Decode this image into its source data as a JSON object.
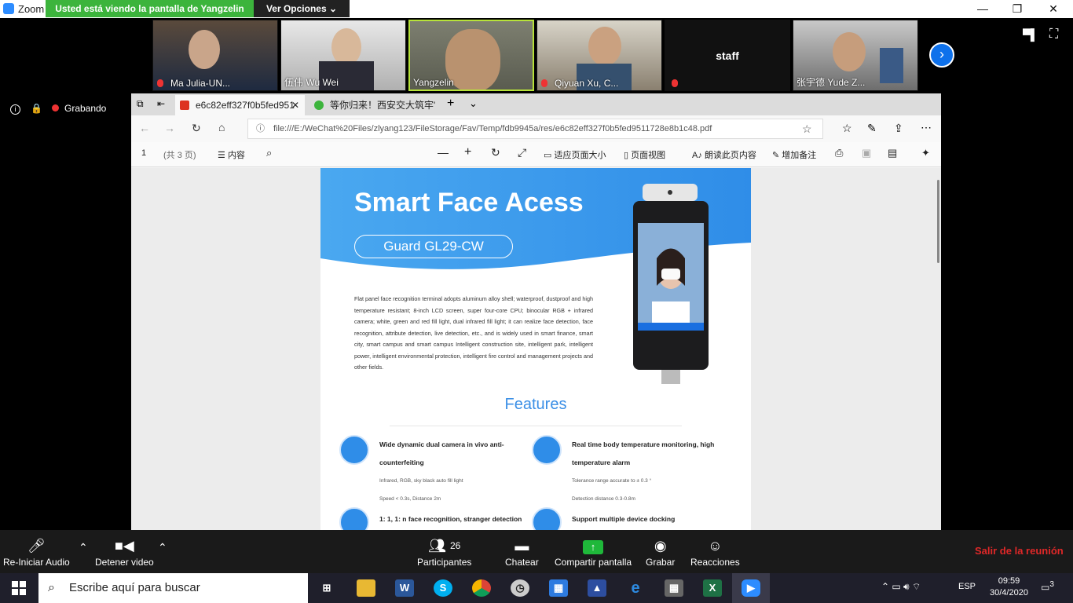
{
  "zoom": {
    "app_title": "Zoom",
    "share_banner": "Usted está viendo la pantalla de Yangzelin",
    "view_options": "Ver Opciones",
    "staff_tile": "staff",
    "recording_label": "Grabando",
    "participants": [
      {
        "name": "Ma Julia-UN..."
      },
      {
        "name": "伍伟   Wu Wei"
      },
      {
        "name": "Yangzelin"
      },
      {
        "name": "Qiyuan Xu, C..."
      },
      {
        "name": "张宇德  Yude Z..."
      }
    ],
    "controls": {
      "audio": "Re-Iniciar Audio",
      "video": "Detener video",
      "participants": "Participantes",
      "participants_count": "26",
      "chat": "Chatear",
      "share": "Compartir pantalla",
      "record": "Grabar",
      "reactions": "Reacciones",
      "leave": "Salir de la reunión"
    }
  },
  "browser": {
    "tabs": [
      {
        "label": "e6c82eff327f0b5fed951"
      },
      {
        "label": "等你归来！西安交大筑牢\"安"
      }
    ],
    "url": "file:///E:/WeChat%20Files/zlyang123/FileStorage/Fav/Temp/fdb9945a/res/e6c82eff327f0b5fed9511728e8b1c48.pdf",
    "pdf_toolbar": {
      "page": "1",
      "page_total": "(共 3 页)",
      "contents": "内容",
      "fit_page": "适应页面大小",
      "page_view": "页面视图",
      "read_aloud": "朗读此页内容",
      "add_note": "增加备注"
    }
  },
  "document": {
    "title": "Smart Face Acess",
    "model": "Guard GL29-CW",
    "description": "Flat panel face recognition terminal adopts aluminum alloy shell; waterproof, dustproof and high temperature resistant; 8-inch LCD screen, super four-core CPU; binocular RGB + infrared camera; white, green and red fill light, dual infrared fill light; it can realize face detection, face recognition, attribute detection, live detection, etc., and is widely used in smart finance, smart city, smart campus and smart campus Intelligent construction site, intelligent park, intelligent power, intelligent environmental protection, intelligent fire control and management projects and other fields.",
    "features_title": "Features",
    "features": [
      {
        "title": "Wide dynamic dual camera in vivo anti-counterfeiting",
        "line1": "Infrared, RGB, sky black auto fill light",
        "line2": "Speed < 0.3s, Distance 2m"
      },
      {
        "title": "Real time body temperature monitoring, high temperature alarm",
        "line1": "Tolerance range accurate to ± 0.3 °",
        "line2": "Detection distance 0.3-0.8m"
      },
      {
        "title": "1: 1, 1: n face recognition, stranger detection"
      },
      {
        "title": "Support multiple device docking"
      }
    ]
  },
  "taskbar": {
    "search_placeholder": "Escribe aquí para buscar",
    "language": "ESP",
    "time": "09:59",
    "date": "30/4/2020",
    "notifications": "3"
  },
  "colors": {
    "zoom_green": "#3cb43c",
    "zoom_blue": "#0e71eb",
    "leave_red": "#e02828",
    "doc_blue": "#2f8de8"
  }
}
